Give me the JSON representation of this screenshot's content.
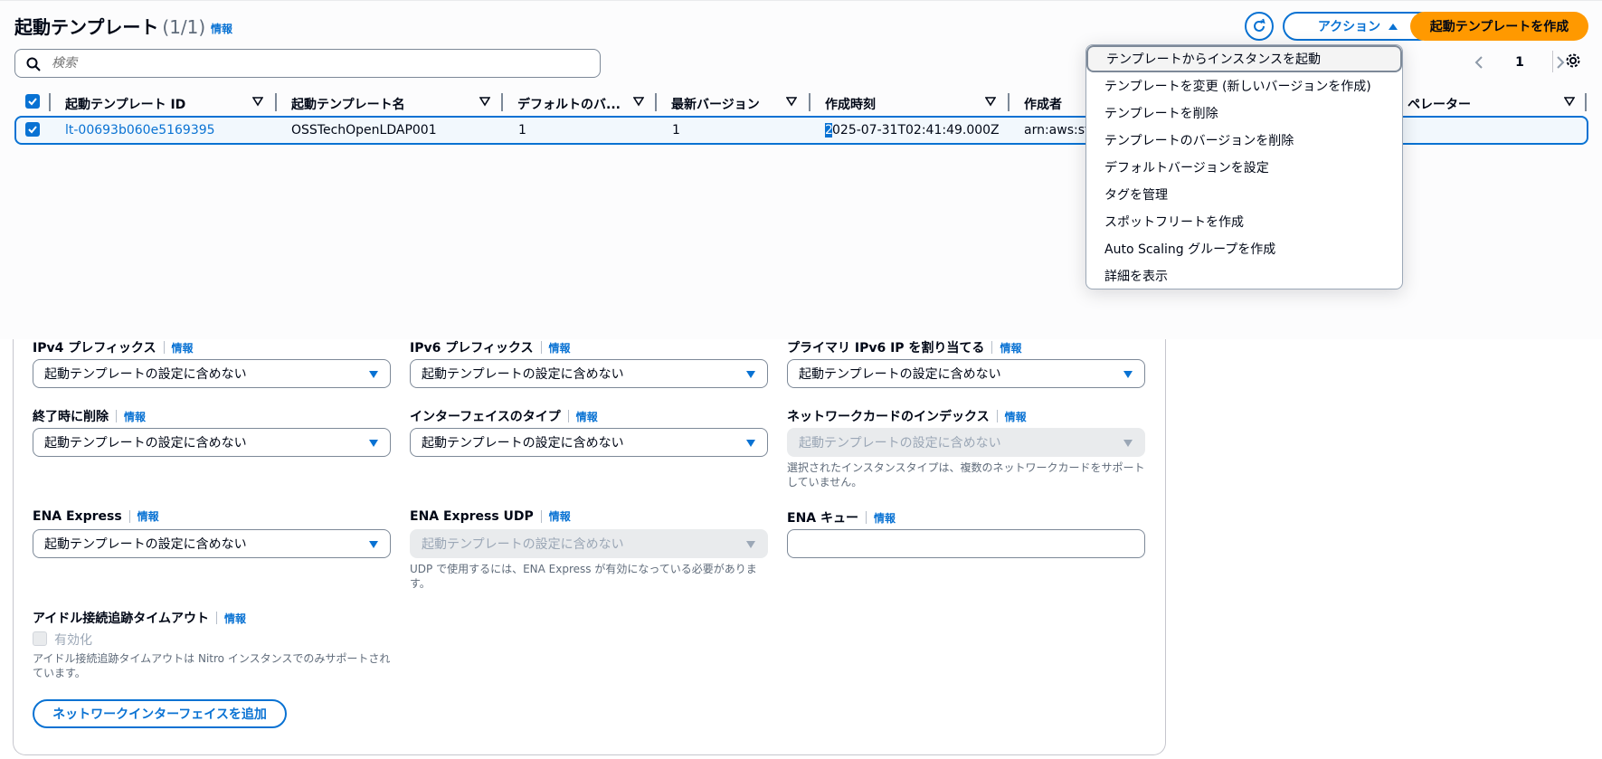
{
  "header": {
    "title": "起動テンプレート",
    "count": "(1/1)",
    "info": "情報",
    "action_label": "アクション",
    "create_label": "起動テンプレートを作成"
  },
  "search": {
    "placeholder": "検索"
  },
  "pagination": {
    "page": "1"
  },
  "table": {
    "columns": [
      "起動テンプレート ID",
      "起動テンプレート名",
      "デフォルトのバ...",
      "最新バージョン",
      "作成時刻",
      "作成者",
      "ペレーター"
    ],
    "row": {
      "id": "lt-00693b060e5169395",
      "name": "OSSTechOpenLDAP001",
      "default_version": "1",
      "latest_version": "1",
      "created_first": "2",
      "created_rest": "025-07-31T02:41:49.000Z",
      "owner": "arn:aws:sts"
    }
  },
  "menu": {
    "items": [
      "テンプレートからインスタンスを起動",
      "テンプレートを変更 (新しいバージョンを作成)",
      "テンプレートを削除",
      "テンプレートのバージョンを削除",
      "デフォルトバージョンを設定",
      "タグを管理",
      "スポットフリートを作成",
      "Auto Scaling グループを作成",
      "詳細を表示"
    ]
  },
  "form": {
    "info": "情報",
    "not_included": "起動テンプレートの設定に含めない",
    "ipv4_prefix": "IPv4 プレフィックス",
    "ipv6_prefix": "IPv6 プレフィックス",
    "primary_ipv6": "プライマリ IPv6 IP を割り当てる",
    "delete_on_term": "終了時に削除",
    "interface_type": "インターフェイスのタイプ",
    "network_card_index": "ネットワークカードのインデックス",
    "network_card_hint": "選択されたインスタンスタイプは、複数のネットワークカードをサポートしていません。",
    "ena_express": "ENA Express",
    "ena_express_udp": "ENA Express UDP",
    "ena_udp_hint": "UDP で使用するには、ENA Express が有効になっている必要があります。",
    "ena_queue": "ENA キュー",
    "idle_timeout": "アイドル接続追跡タイムアウト",
    "enable": "有効化",
    "idle_hint": "アイドル接続追跡タイムアウトは Nitro インスタンスでのみサポートされています。",
    "add_nic": "ネットワークインターフェイスを追加"
  },
  "colors": {
    "accent": "#0972d3",
    "primary_button": "#ff9900"
  }
}
